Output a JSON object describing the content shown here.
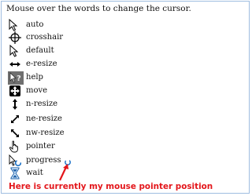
{
  "intro_text": "Mouse over the words to change the cursor.",
  "cursors": [
    {
      "label": "auto",
      "icon": "arrow-pointer-icon"
    },
    {
      "label": "crosshair",
      "icon": "crosshair-icon"
    },
    {
      "label": "default",
      "icon": "default-arrow-icon"
    },
    {
      "label": "e-resize",
      "icon": "e-resize-icon"
    },
    {
      "label": "help",
      "icon": "help-icon"
    },
    {
      "label": "move",
      "icon": "move-icon"
    },
    {
      "label": "n-resize",
      "icon": "n-resize-icon"
    },
    {
      "label": "ne-resize",
      "icon": "ne-resize-icon"
    },
    {
      "label": "nw-resize",
      "icon": "nw-resize-icon"
    },
    {
      "label": "pointer",
      "icon": "hand-pointer-icon"
    },
    {
      "label": "progress",
      "icon": "progress-icon"
    },
    {
      "label": "wait",
      "icon": "hourglass-icon"
    }
  ],
  "caption": "Here is currently my mouse pointer position",
  "accent_color": "#e3161b"
}
